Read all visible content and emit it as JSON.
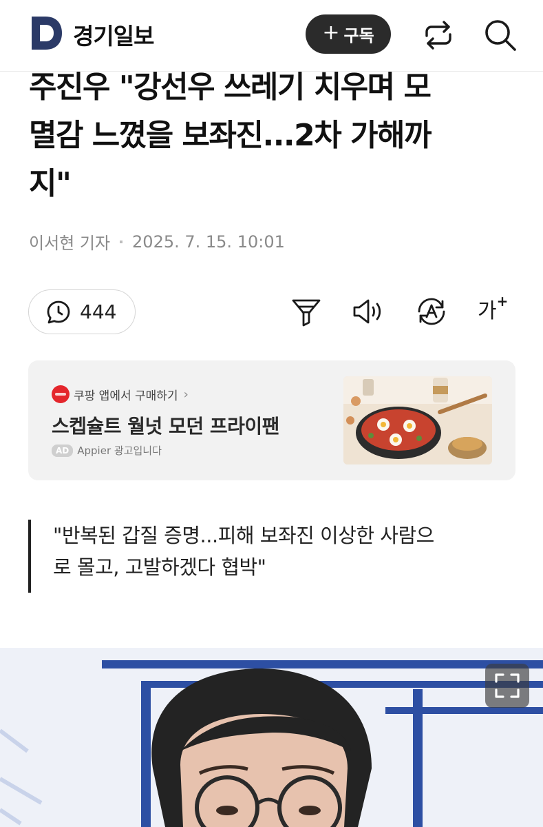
{
  "header": {
    "logo_letter": "D",
    "brand": "경기일보",
    "subscribe_plus": "+",
    "subscribe_label": "구독"
  },
  "article": {
    "headline_lines": [
      "주진우 \"강선우 쓰레기 치우며 모",
      "멸감 느꼈을 보좌진...2차 가해까",
      "지\""
    ],
    "reporter": "이서현 기자",
    "datetime": "2025. 7. 15. 10:01",
    "comment_count": "444",
    "font_tool_label": "가",
    "font_tool_plus": "+",
    "subheading_lines": [
      "\"반복된 갑질 증명...피해 보좌진 이상한 사람으",
      "로 몰고, 고발하겠다 협박\""
    ]
  },
  "ad": {
    "source": "쿠팡 앱에서 구매하기",
    "source_chevron": "›",
    "title": "스켑슐트 월넛 모던 프라이팬",
    "badge": "AD",
    "advertiser": "Appier 광고입니다"
  },
  "icons": {
    "share": "share-icon",
    "search": "search-icon",
    "comment": "comment-bubble-icon",
    "filter": "summary-funnel-icon",
    "sound": "speaker-icon",
    "translate": "translate-icon",
    "expand": "fullscreen-icon"
  },
  "colors": {
    "brand_navy": "#2b3a67",
    "subscribe_bg": "#2b2b2b",
    "text_dark": "#111111",
    "text_muted": "#8a8a8a",
    "ad_bg": "#f2f2f2",
    "coupang_red": "#e4262c"
  }
}
